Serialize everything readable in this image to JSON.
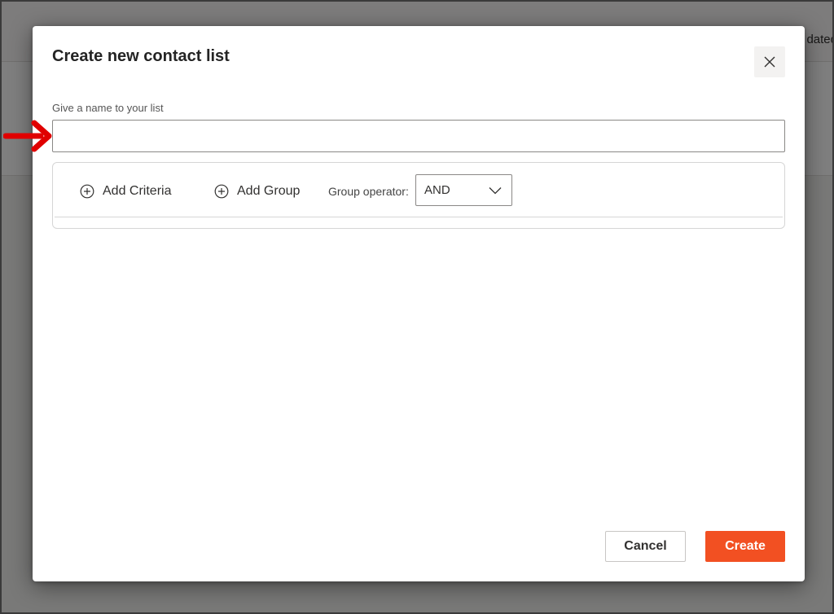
{
  "background": {
    "header_text": "dated"
  },
  "dialog": {
    "title": "Create new contact list",
    "close_label": "Close",
    "name_field": {
      "label": "Give a name to your list",
      "value": "",
      "placeholder": ""
    },
    "criteria": {
      "add_criteria_label": "Add Criteria",
      "add_group_label": "Add Group",
      "group_operator_label": "Group operator:",
      "group_operator_value": "AND"
    },
    "footer": {
      "cancel_label": "Cancel",
      "create_label": "Create"
    }
  },
  "colors": {
    "primary_button": "#f25022",
    "annotation_arrow": "#e00000",
    "overlay": "#7d7c80"
  },
  "icons": {
    "close": "close-icon",
    "add_criteria": "plus-circle-icon",
    "add_group": "plus-circle-icon",
    "dropdown": "chevron-down-icon",
    "annotation": "red-arrow-icon"
  }
}
